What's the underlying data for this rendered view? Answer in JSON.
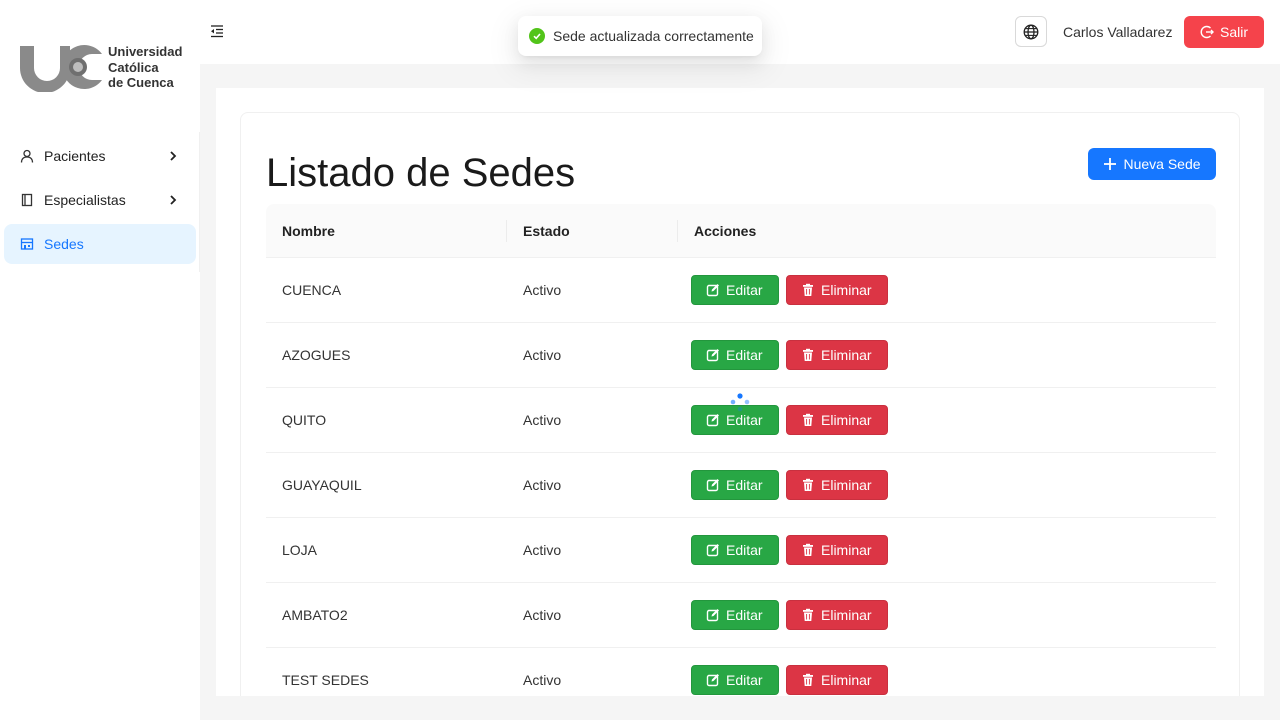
{
  "brand": {
    "logo_lines": [
      "Universidad",
      "Católica",
      "de Cuenca"
    ]
  },
  "sidebar": {
    "items": [
      {
        "label": "Pacientes",
        "icon": "user-icon"
      },
      {
        "label": "Especialistas",
        "icon": "book-icon"
      },
      {
        "label": "Sedes",
        "icon": "building-icon",
        "active": true
      }
    ]
  },
  "header": {
    "user_name": "Carlos Valladarez",
    "logout_label": "Salir"
  },
  "toast": {
    "message": "Sede actualizada correctamente"
  },
  "page": {
    "title": "Listado de Sedes",
    "new_button_label": "Nueva Sede"
  },
  "table": {
    "columns": [
      "Nombre",
      "Estado",
      "Acciones"
    ],
    "edit_label": "Editar",
    "delete_label": "Eliminar",
    "rows": [
      {
        "nombre": "CUENCA",
        "estado": "Activo"
      },
      {
        "nombre": "AZOGUES",
        "estado": "Activo"
      },
      {
        "nombre": "QUITO",
        "estado": "Activo"
      },
      {
        "nombre": "GUAYAQUIL",
        "estado": "Activo"
      },
      {
        "nombre": "LOJA",
        "estado": "Activo"
      },
      {
        "nombre": "AMBATO2",
        "estado": "Activo"
      },
      {
        "nombre": "TEST SEDES",
        "estado": "Activo"
      }
    ]
  },
  "colors": {
    "primary": "#1677ff",
    "success": "#28a745",
    "danger": "#dc3545",
    "logout": "#f5434b",
    "active_bg": "#e6f4ff"
  }
}
